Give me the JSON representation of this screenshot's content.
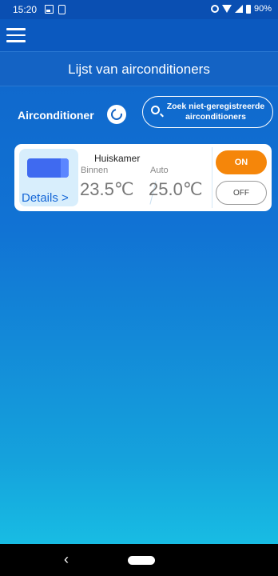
{
  "status_bar": {
    "time": "15:20",
    "battery": "90%",
    "icons": [
      "image-icon",
      "download-icon",
      "vibrate-icon",
      "wifi-icon",
      "signal-icon",
      "battery-icon"
    ]
  },
  "app_bar": {
    "menu_icon": "hamburger-menu-icon"
  },
  "header": {
    "title": "Lijst van airconditioners"
  },
  "section": {
    "label": "Airconditioner",
    "refresh_icon": "refresh-icon",
    "search_button_line1": "Zoek niet-geregistreerde",
    "search_button_line2": "airconditioners",
    "search_icon": "search-icon"
  },
  "devices": [
    {
      "name": "Huiskamer",
      "indoor_label": "Binnen",
      "mode_label": "Auto",
      "indoor_temp": "23.5℃",
      "set_temp": "25.0℃",
      "details_label": "Details",
      "details_chevron": ">",
      "on_label": "ON",
      "off_label": "OFF",
      "power_state": "on"
    }
  ],
  "nav_bar": {
    "back_glyph": "‹",
    "home_icon": "home-pill-icon"
  },
  "colors": {
    "header_bg": "#0b59bf",
    "accent_orange": "#f5860a",
    "link_blue": "#1466d6"
  }
}
